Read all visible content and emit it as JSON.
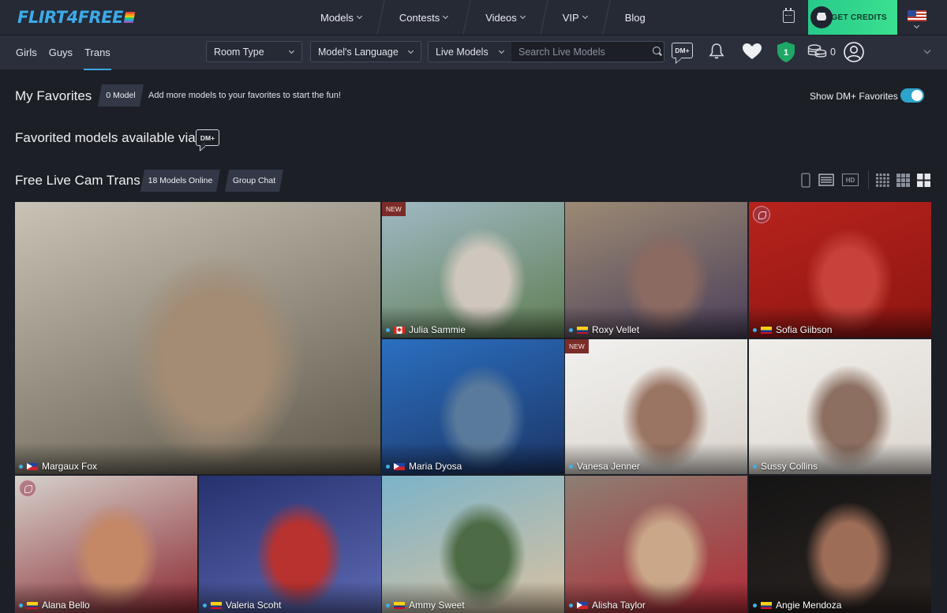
{
  "brand": {
    "logo_text": "FLIRT4FREE"
  },
  "main_nav": [
    {
      "label": "Models",
      "has_dropdown": true
    },
    {
      "label": "Contests",
      "has_dropdown": true
    },
    {
      "label": "Videos",
      "has_dropdown": true
    },
    {
      "label": "VIP",
      "has_dropdown": true
    },
    {
      "label": "Blog",
      "has_dropdown": false
    }
  ],
  "header": {
    "credits_label": "GET CREDITS",
    "coin_count": "0",
    "accent": "#2fd38c"
  },
  "gender_tabs": [
    {
      "label": "Girls",
      "active": false
    },
    {
      "label": "Guys",
      "active": false
    },
    {
      "label": "Trans",
      "active": true
    }
  ],
  "filters": {
    "room_type": "Room Type",
    "language": "Model's Language",
    "live": "Live Models",
    "search_placeholder": "Search Live Models"
  },
  "badges": {
    "dm": "DM+",
    "rewards_level": "1"
  },
  "favorites": {
    "title": "My Favorites",
    "count_label": "0 Model",
    "hint": "Add more models to your favorites to start the fun!",
    "toggle_label": "Show DM+ Favorites",
    "toggle_on": true
  },
  "dm_section": {
    "title": "Favorited models available via"
  },
  "cams": {
    "title": "Free Live Cam Trans",
    "online_label": "18 Models Online",
    "group_chat_label": "Group Chat",
    "hd_label": "HD"
  },
  "models": [
    {
      "name": "Margaux Fox",
      "flag": "ph",
      "new": false,
      "bg": [
        "#c9c3b6",
        "#5e584a",
        "#a38b74"
      ]
    },
    {
      "name": "Julia Sammie",
      "flag": "ca",
      "new": true,
      "bg": [
        "#9fb9c4",
        "#5f7d52",
        "#cfc7bd"
      ]
    },
    {
      "name": "Roxy Vellet",
      "flag": "co",
      "new": false,
      "bg": [
        "#9c8a74",
        "#4b3f59",
        "#8b6a62"
      ]
    },
    {
      "name": "Sofia Giibson",
      "flag": "co",
      "new": false,
      "bg": [
        "#b7231d",
        "#8e1512",
        "#c6423a"
      ]
    },
    {
      "name": "Maria Dyosa",
      "flag": "ph",
      "new": false,
      "bg": [
        "#2b6fc0",
        "#1c3566",
        "#5a7a9c"
      ]
    },
    {
      "name": "Vanesa Jenner",
      "flag": "",
      "new": true,
      "bg": [
        "#f2f1ef",
        "#d8d2cb",
        "#9a7563"
      ]
    },
    {
      "name": "Sussy Collins",
      "flag": "",
      "new": false,
      "bg": [
        "#f0eeea",
        "#dcd6cf",
        "#8c6f61"
      ]
    },
    {
      "name": "Alana Bello",
      "flag": "co",
      "new": false,
      "bg": [
        "#d5d1cb",
        "#8b2a33",
        "#c48867"
      ]
    },
    {
      "name": "Valeria Scoht",
      "flag": "co",
      "new": false,
      "bg": [
        "#26316e",
        "#5d69b3",
        "#b8322f"
      ]
    },
    {
      "name": "Ammy Sweet",
      "flag": "co",
      "new": false,
      "bg": [
        "#7bb3c9",
        "#d9c2a1",
        "#4d6b45"
      ]
    },
    {
      "name": "Alisha Taylor",
      "flag": "ph",
      "new": false,
      "bg": [
        "#8c7f73",
        "#b12b36",
        "#caa789"
      ]
    },
    {
      "name": "Angie Mendoza",
      "flag": "co",
      "new": false,
      "bg": [
        "#141414",
        "#2d2522",
        "#9e6d58"
      ]
    }
  ]
}
